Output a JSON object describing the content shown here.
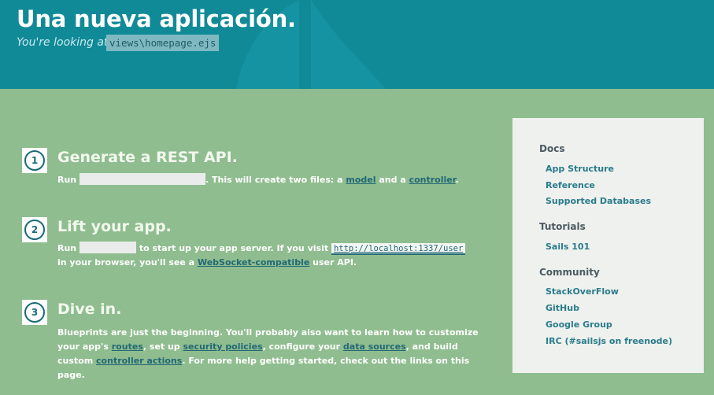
{
  "header": {
    "title": "Una nueva aplicación.",
    "looking_label": "You're looking at:",
    "file": "views\\homepage.ejs"
  },
  "steps": [
    {
      "number": "1",
      "title": "Generate a REST API.",
      "text": {
        "run": "Run",
        "after_blank": ". This will create two files: a",
        "model_link": "model",
        "and_a": "and a",
        "controller_link": "controller",
        "end": "."
      }
    },
    {
      "number": "2",
      "title": "Lift your app.",
      "text": {
        "run": "Run",
        "after_blank": "to start up your app server. If you visit",
        "url": "http://localhost:1337/user",
        "line2_start": "in your browser, you'll see a",
        "websocket_link": "WebSocket-compatible",
        "line2_end": "user API."
      }
    },
    {
      "number": "3",
      "title": "Dive in.",
      "text": {
        "line1": "Blueprints are just the beginning. You'll probably also want to learn how to customize",
        "line2_a": "your app's",
        "routes_link": "routes",
        "line2_b": ", set up",
        "security_link": "security policies",
        "line2_c": ", configure your",
        "datasources_link": "data sources",
        "line2_d": ", and build",
        "line3_a": "custom",
        "actions_link": "controller actions",
        "line3_b": ". For more help getting started, check out the links on this",
        "line4": "page."
      }
    }
  ],
  "sidebar": {
    "docs": {
      "heading": "Docs",
      "links": [
        "App Structure",
        "Reference",
        "Supported Databases"
      ]
    },
    "tutorials": {
      "heading": "Tutorials",
      "links": [
        "Sails 101"
      ]
    },
    "community": {
      "heading": "Community",
      "links": [
        "StackOverFlow",
        "GitHub",
        "Google Group",
        "IRC (#sailsjs on freenode)"
      ]
    }
  }
}
